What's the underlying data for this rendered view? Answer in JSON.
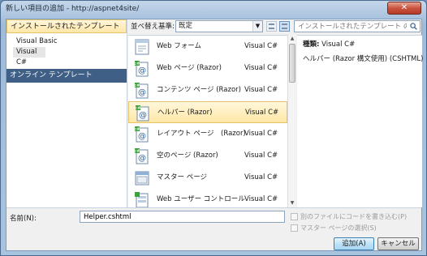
{
  "window": {
    "title": "新しい項目の追加 - http://aspnet4site/",
    "close_glyph": "✕"
  },
  "left_pane": {
    "installed_header": "インストールされたテンプレート",
    "items": [
      "Visual Basic",
      "Visual C#"
    ],
    "selected_item": "Visual C#",
    "online_header": "オンライン テンプレート"
  },
  "toolbar": {
    "sort_label": "並べ替え基準:",
    "sort_value": "既定",
    "search_placeholder": "インストールされたテンプレート の検索"
  },
  "templates": [
    {
      "name": "Web フォーム",
      "lang": "Visual C#",
      "icon": "web-form-icon"
    },
    {
      "name": "Web ページ (Razor)",
      "lang": "Visual C#",
      "icon": "razor-page-icon"
    },
    {
      "name": "コンテンツ ページ (Razor)",
      "lang": "Visual C#",
      "icon": "razor-page-icon"
    },
    {
      "name": "ヘルパー (Razor)",
      "lang": "Visual C#",
      "icon": "razor-page-icon"
    },
    {
      "name": "レイアウト ページ　(Razor)",
      "lang": "Visual C#",
      "icon": "razor-page-icon"
    },
    {
      "name": "空のページ (Razor)",
      "lang": "Visual C#",
      "icon": "razor-page-icon"
    },
    {
      "name": "マスター ページ",
      "lang": "Visual C#",
      "icon": "master-page-icon"
    },
    {
      "name": "Web ユーザー コントロール",
      "lang": "Visual C#",
      "icon": "user-control-icon"
    }
  ],
  "selected_template": "ヘルパー (Razor)",
  "details": {
    "type_label": "種類:",
    "type_value": "Visual C#",
    "description": "ヘルパー (Razor 構文使用) (CSHTML)"
  },
  "bottom": {
    "name_label": "名前(N):",
    "name_value": "Helper.cshtml",
    "check_separate_file": "別のファイルにコードを書き込む(P)",
    "check_master_page": "マスター ページの選択(S)",
    "add_button": "追加(A)",
    "cancel_button": "キャンセル"
  },
  "colors": {
    "selection": "#ffe8a6",
    "online_header_bg": "#3f5f86",
    "title_bar": "#a9c3de"
  }
}
